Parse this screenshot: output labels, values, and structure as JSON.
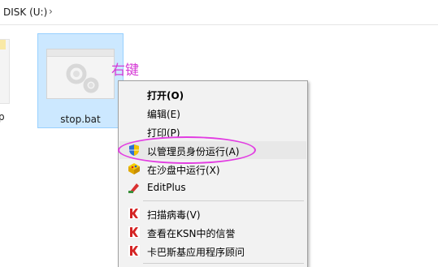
{
  "address_bar": {
    "path_text": "DISK (U:)",
    "separator": "›"
  },
  "files": {
    "partial_caption": "p",
    "selected_file_name": "stop.bat"
  },
  "annotation": {
    "text": "右键",
    "color": "#d63bd6"
  },
  "context_menu": {
    "items": [
      {
        "label": "打开(O)",
        "bold": true,
        "icon": "none"
      },
      {
        "label": "编辑(E)",
        "bold": false,
        "icon": "none"
      },
      {
        "label": "打印(P)",
        "bold": false,
        "icon": "none"
      },
      {
        "label": "以管理员身份运行(A)",
        "bold": false,
        "icon": "uac-shield-icon",
        "highlighted": true
      },
      {
        "label": "在沙盘中运行(X)",
        "bold": false,
        "icon": "sandboxie-icon"
      },
      {
        "label": "EditPlus",
        "bold": false,
        "icon": "editplus-icon"
      },
      {
        "label": "扫描病毒(V)",
        "bold": false,
        "icon": "kaspersky-icon"
      },
      {
        "label": "查看在KSN中的信誉",
        "bold": false,
        "icon": "kaspersky-icon"
      },
      {
        "label": "卡巴斯基应用程序顾问",
        "bold": false,
        "icon": "kaspersky-icon"
      }
    ]
  },
  "colors": {
    "selection_fill": "#cce8ff",
    "selection_border": "#99d1ff",
    "highlight_ring": "#e23de2",
    "menu_bg": "#f2f2f2"
  }
}
